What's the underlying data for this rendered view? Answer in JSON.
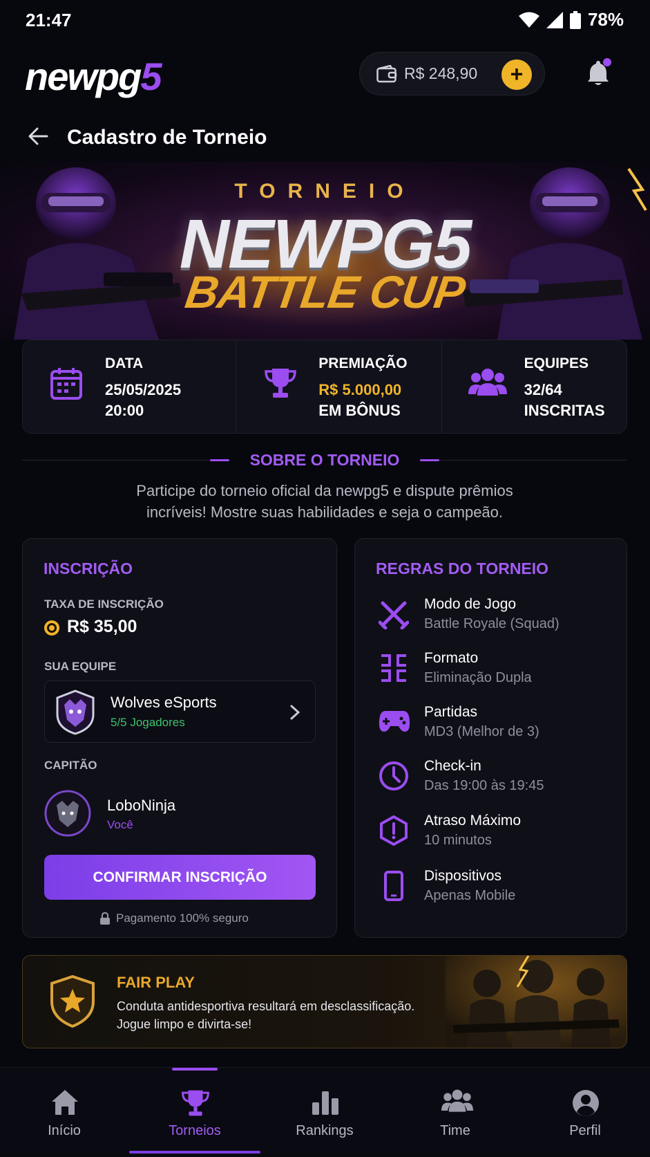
{
  "status_bar": {
    "time": "21:47",
    "battery": "78%"
  },
  "header": {
    "logo_main": "newpg",
    "logo_accent": "5",
    "balance": "R$ 248,90",
    "add_label": "+"
  },
  "page": {
    "title": "Cadastro de Torneio"
  },
  "banner": {
    "line1": "TORNEIO",
    "line2": "NEWPG5",
    "line3": "BATTLE CUP"
  },
  "stats": [
    {
      "label": "DATA",
      "line1": "25/05/2025",
      "line2": "20:00",
      "icon": "calendar-icon"
    },
    {
      "label": "PREMIAÇÃO",
      "line1": "R$ 5.000,00",
      "line2": "EM BÔNUS",
      "icon": "trophy-icon"
    },
    {
      "label": "EQUIPES",
      "line1": "32/64",
      "line2": "INSCRITAS",
      "icon": "users-icon"
    }
  ],
  "about": {
    "title": "SOBRE O TORNEIO",
    "desc1": "Participe do torneio oficial da newpg5 e dispute prêmios",
    "desc2": "incríveis! Mostre suas habilidades e seja o campeão."
  },
  "registration": {
    "title": "INSCRIÇÃO",
    "fee_label": "TAXA DE INSCRIÇÃO",
    "fee_value": "R$ 35,00",
    "team_label": "SUA EQUIPE",
    "team_name": "Wolves eSports",
    "team_players": "5/5 Jogadores",
    "captain_label": "CAPITÃO",
    "captain_name": "LoboNinja",
    "captain_tag": "Você",
    "confirm_button": "CONFIRMAR INSCRIÇÃO",
    "secure_text": "Pagamento 100% seguro"
  },
  "rules": {
    "title": "REGRAS DO TORNEIO",
    "items": [
      {
        "title": "Modo de Jogo",
        "value": "Battle Royale (Squad)",
        "icon": "crossed-swords-icon"
      },
      {
        "title": "Formato",
        "value": "Eliminação Dupla",
        "icon": "bracket-icon"
      },
      {
        "title": "Partidas",
        "value": "MD3 (Melhor de 3)",
        "icon": "gamepad-icon"
      },
      {
        "title": "Check-in",
        "value": "Das 19:00 às 19:45",
        "icon": "clock-icon"
      },
      {
        "title": "Atraso Máximo",
        "value": "10 minutos",
        "icon": "alert-icon"
      },
      {
        "title": "Dispositivos",
        "value": "Apenas Mobile",
        "icon": "phone-icon"
      }
    ]
  },
  "fair_play": {
    "title": "FAIR PLAY",
    "line1": "Conduta antidesportiva resultará em desclassificação.",
    "line2": "Jogue limpo e divirta-se!"
  },
  "nav": [
    {
      "label": "Início",
      "icon": "home-icon",
      "active": false
    },
    {
      "label": "Torneios",
      "icon": "trophy-icon",
      "active": true
    },
    {
      "label": "Rankings",
      "icon": "bar-chart-icon",
      "active": false
    },
    {
      "label": "Time",
      "icon": "users-icon",
      "active": false
    },
    {
      "label": "Perfil",
      "icon": "profile-icon",
      "active": false
    }
  ],
  "colors": {
    "accent": "#9b4df0",
    "gold": "#f0b429",
    "success": "#3ec46d",
    "background": "#07070e"
  }
}
